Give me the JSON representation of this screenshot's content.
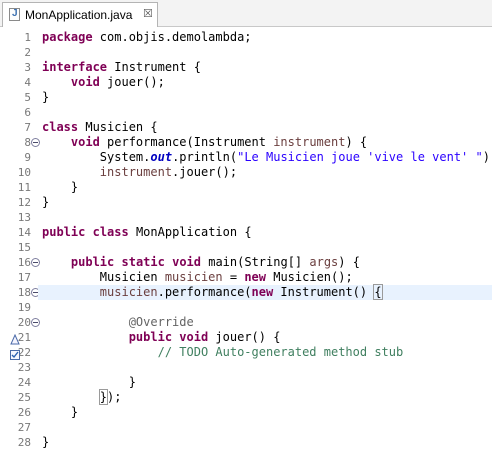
{
  "tab": {
    "title": "MonApplication.java",
    "icon": "java-file-icon",
    "close": "☒"
  },
  "colors": {
    "keyword": "#7f0055",
    "comment": "#3f7f5f",
    "string": "#2a00ff",
    "field": "#0000c0",
    "annotation": "#646464",
    "current_line": "#e8f2fe"
  },
  "current_line": 18,
  "code": [
    {
      "n": "1",
      "segments": [
        {
          "t": "package",
          "c": "kw"
        },
        {
          "t": " com.objis.demolambda;",
          "c": ""
        }
      ]
    },
    {
      "n": "2",
      "segments": []
    },
    {
      "n": "3",
      "segments": [
        {
          "t": "interface",
          "c": "kw"
        },
        {
          "t": " Instrument {",
          "c": ""
        }
      ]
    },
    {
      "n": "4",
      "segments": [
        {
          "t": "    ",
          "c": ""
        },
        {
          "t": "void",
          "c": "kw"
        },
        {
          "t": " jouer();",
          "c": ""
        }
      ]
    },
    {
      "n": "5",
      "segments": [
        {
          "t": "}",
          "c": ""
        }
      ]
    },
    {
      "n": "6",
      "segments": []
    },
    {
      "n": "7",
      "segments": [
        {
          "t": "class",
          "c": "kw"
        },
        {
          "t": " Musicien {",
          "c": ""
        }
      ]
    },
    {
      "n": "8",
      "fold": true,
      "segments": [
        {
          "t": "    ",
          "c": ""
        },
        {
          "t": "void",
          "c": "kw"
        },
        {
          "t": " performance(Instrument ",
          "c": ""
        },
        {
          "t": "instrument",
          "c": "vr"
        },
        {
          "t": ") {",
          "c": ""
        }
      ]
    },
    {
      "n": "9",
      "segments": [
        {
          "t": "        System.",
          "c": ""
        },
        {
          "t": "out",
          "c": "fi"
        },
        {
          "t": ".println(",
          "c": ""
        },
        {
          "t": "\"Le Musicien joue 'vive le vent' \"",
          "c": "st"
        },
        {
          "t": ");",
          "c": ""
        }
      ]
    },
    {
      "n": "10",
      "segments": [
        {
          "t": "        ",
          "c": ""
        },
        {
          "t": "instrument",
          "c": "vr"
        },
        {
          "t": ".jouer();",
          "c": ""
        }
      ]
    },
    {
      "n": "11",
      "segments": [
        {
          "t": "    }",
          "c": ""
        }
      ]
    },
    {
      "n": "12",
      "segments": [
        {
          "t": "}",
          "c": ""
        }
      ]
    },
    {
      "n": "13",
      "segments": []
    },
    {
      "n": "14",
      "segments": [
        {
          "t": "public",
          "c": "kw"
        },
        {
          "t": " ",
          "c": ""
        },
        {
          "t": "class",
          "c": "kw"
        },
        {
          "t": " MonApplication {",
          "c": ""
        }
      ]
    },
    {
      "n": "15",
      "segments": []
    },
    {
      "n": "16",
      "fold": true,
      "segments": [
        {
          "t": "    ",
          "c": ""
        },
        {
          "t": "public",
          "c": "kw"
        },
        {
          "t": " ",
          "c": ""
        },
        {
          "t": "static",
          "c": "kw"
        },
        {
          "t": " ",
          "c": ""
        },
        {
          "t": "void",
          "c": "kw"
        },
        {
          "t": " main(String[] ",
          "c": ""
        },
        {
          "t": "args",
          "c": "vr"
        },
        {
          "t": ") {",
          "c": ""
        }
      ]
    },
    {
      "n": "17",
      "segments": [
        {
          "t": "        Musicien ",
          "c": ""
        },
        {
          "t": "musicien",
          "c": "vr"
        },
        {
          "t": " = ",
          "c": ""
        },
        {
          "t": "new",
          "c": "kw"
        },
        {
          "t": " Musicien();",
          "c": ""
        }
      ]
    },
    {
      "n": "18",
      "fold": true,
      "segments": [
        {
          "t": "        ",
          "c": ""
        },
        {
          "t": "musicien",
          "c": "vr"
        },
        {
          "t": ".performance(",
          "c": ""
        },
        {
          "t": "new",
          "c": "kw"
        },
        {
          "t": " Instrument() ",
          "c": ""
        },
        {
          "t": "{",
          "c": "bracket"
        },
        {
          "t": "",
          "c": "caret"
        }
      ]
    },
    {
      "n": "19",
      "segments": []
    },
    {
      "n": "20",
      "fold": true,
      "segments": [
        {
          "t": "            ",
          "c": ""
        },
        {
          "t": "@Override",
          "c": "an"
        }
      ]
    },
    {
      "n": "21",
      "override": true,
      "segments": [
        {
          "t": "            ",
          "c": ""
        },
        {
          "t": "public",
          "c": "kw"
        },
        {
          "t": " ",
          "c": ""
        },
        {
          "t": "void",
          "c": "kw"
        },
        {
          "t": " jouer() {",
          "c": ""
        }
      ]
    },
    {
      "n": "22",
      "task": true,
      "segments": [
        {
          "t": "                ",
          "c": ""
        },
        {
          "t": "// TODO Auto-generated method stub",
          "c": "cm"
        }
      ]
    },
    {
      "n": "23",
      "segments": []
    },
    {
      "n": "24",
      "segments": [
        {
          "t": "            }",
          "c": ""
        }
      ]
    },
    {
      "n": "25",
      "segments": [
        {
          "t": "        ",
          "c": ""
        },
        {
          "t": "}",
          "c": "bracket"
        },
        {
          "t": ");",
          "c": ""
        }
      ]
    },
    {
      "n": "26",
      "segments": [
        {
          "t": "    }",
          "c": ""
        }
      ]
    },
    {
      "n": "27",
      "segments": []
    },
    {
      "n": "28",
      "segments": [
        {
          "t": "}",
          "c": ""
        }
      ]
    }
  ]
}
